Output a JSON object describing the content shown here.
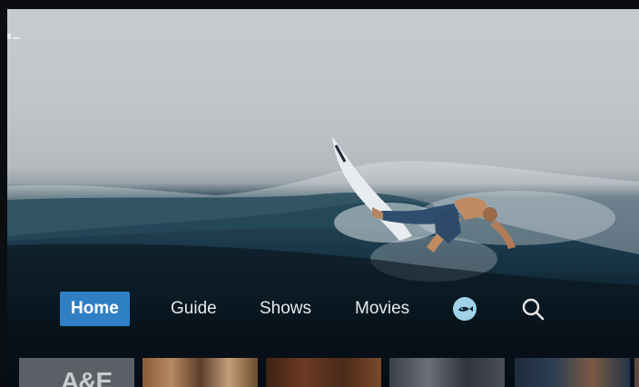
{
  "hero": {
    "background": "surfer riding a wave"
  },
  "nav": {
    "items": [
      {
        "label": "Home",
        "active": true
      },
      {
        "label": "Guide",
        "active": false
      },
      {
        "label": "Shows",
        "active": false
      },
      {
        "label": "Movies",
        "active": false
      }
    ],
    "profile_icon": "fish-avatar-icon",
    "search_icon": "search-icon"
  },
  "thumbnails": [
    {
      "title": "A&E",
      "color": "#5b6066"
    },
    {
      "title": "",
      "color": "#6b4a2c"
    },
    {
      "title": "",
      "color": "#5a3320"
    },
    {
      "title": "",
      "color": "#4a4f55"
    },
    {
      "title": "",
      "color": "#23354a"
    }
  ],
  "colors": {
    "accent": "#2f7fc4",
    "profile": "#9fd3ea"
  }
}
